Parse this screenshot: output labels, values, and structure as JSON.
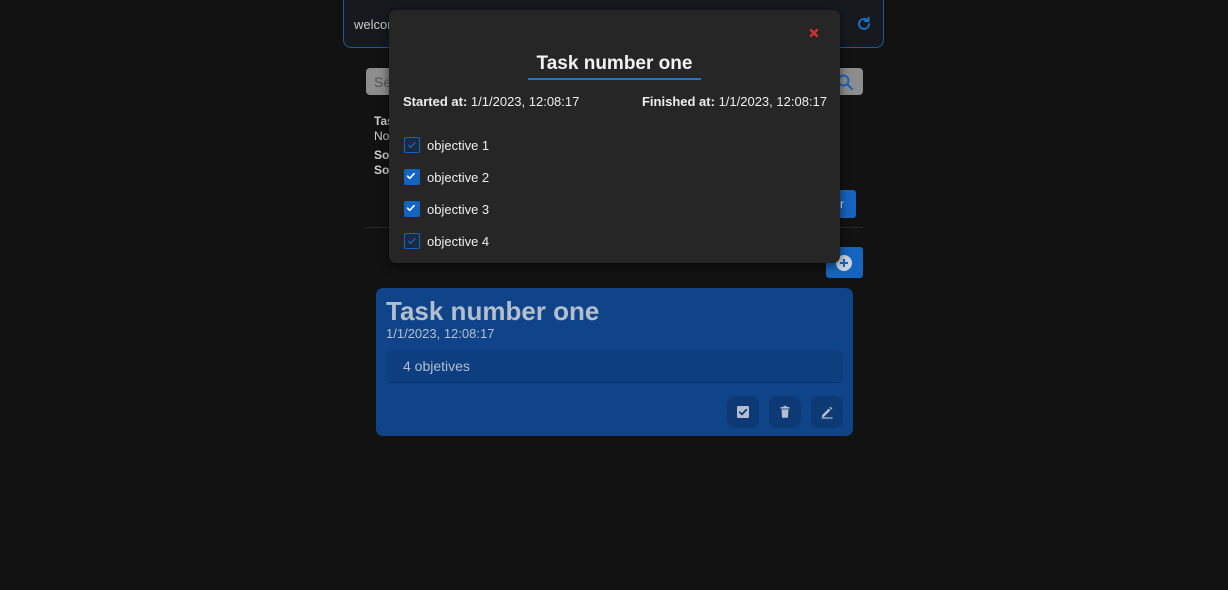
{
  "header": {
    "welcome_text": "welcor",
    "refresh_icon": "refresh-icon"
  },
  "search": {
    "placeholder": "Se",
    "button_icon": "search-icon"
  },
  "meta": {
    "line1": "Tas",
    "line2": "No",
    "line3": "So",
    "line4": "So"
  },
  "filter_button": {
    "label": "r"
  },
  "add_button": {
    "icon": "plus-circle-icon"
  },
  "task_card": {
    "title": "Task number one",
    "date": "1/1/2023, 12:08:17",
    "objectives_summary": "4 objetives",
    "actions": [
      "check-icon",
      "trash-icon",
      "edit-icon"
    ]
  },
  "modal": {
    "title": "Task number one",
    "started_label": "Started at:",
    "started_value": "1/1/2023, 12:08:17",
    "finished_label": "Finished at:",
    "finished_value": "1/1/2023, 12:08:17",
    "close_icon": "close-icon",
    "objectives": [
      {
        "label": "objective 1",
        "checked": false
      },
      {
        "label": "objective 2",
        "checked": true
      },
      {
        "label": "objective 3",
        "checked": true
      },
      {
        "label": "objective 4",
        "checked": false
      }
    ]
  },
  "colors": {
    "accent": "#1565c0",
    "modal_bg": "#262626",
    "card_bg": "#0f4488",
    "close": "#d32f2f"
  }
}
